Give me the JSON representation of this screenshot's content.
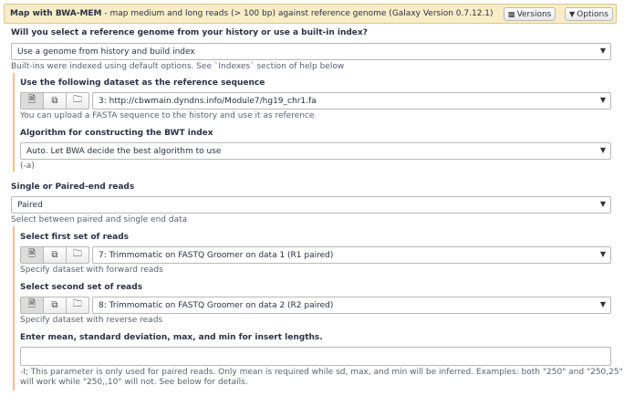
{
  "header": {
    "title_bold": "Map with BWA-MEM",
    "title_rest": " - map medium and long reads (> 100 bp) against reference genome (Galaxy Version 0.7.12.1)",
    "versions_label": "Versions",
    "options_label": "Options"
  },
  "reference": {
    "label": "Will you select a reference genome from your history or use a built-in index?",
    "value": "Use a genome from history and build index",
    "help": "Built-ins were indexed using default options. See `Indexes` section of help below",
    "dataset_label": "Use the following dataset as the reference sequence",
    "dataset_value": "3: http://cbwmain.dyndns.info/Module7/hg19_chr1.fa",
    "dataset_help": "You can upload a FASTA sequence to the history and use it as reference",
    "algo_label": "Algorithm for constructing the BWT index",
    "algo_value": "Auto. Let BWA decide the best algorithm to use",
    "algo_help": "(-a)"
  },
  "reads": {
    "label": "Single or Paired-end reads",
    "value": "Paired",
    "help": "Select between paired and single end data",
    "first_label": "Select first set of reads",
    "first_value": "7: Trimmomatic on FASTQ Groomer on data 1 (R1 paired)",
    "first_help": "Specify dataset with forward reads",
    "second_label": "Select second set of reads",
    "second_value": "8: Trimmomatic on FASTQ Groomer on data 2 (R2 paired)",
    "second_help": "Specify dataset with reverse reads",
    "insert_label": "Enter mean, standard deviation, max, and min for insert lengths.",
    "insert_value": "",
    "insert_help_1": "-I; This parameter is only used for paired reads. Only mean is required while sd, max, and min will be inferred. Examples: both \"250\" and \"250,25\"",
    "insert_help_2": "will work while \"250,,10\" will not. See below for details."
  },
  "icons": {
    "versions": "cubes-icon",
    "options": "caret-down-icon",
    "single": "file-icon",
    "multiple": "files-icon",
    "collection": "folder-icon",
    "dropdown": "caret-down-icon"
  }
}
